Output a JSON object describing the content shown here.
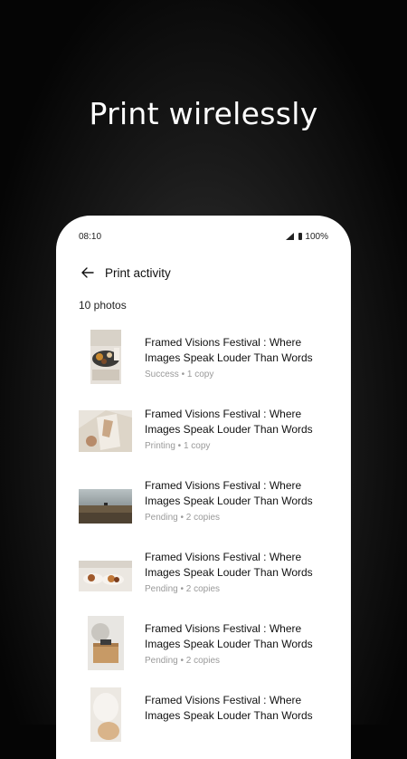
{
  "headline": "Print wirelessly",
  "status_bar": {
    "time": "08:10",
    "battery": "100%"
  },
  "appbar": {
    "title": "Print activity",
    "back_icon": "arrow-left-icon"
  },
  "count_label": "10 photos",
  "items": [
    {
      "title": "Framed Visions Festival : Where Images Speak Louder Than Words",
      "status": "Success",
      "copies": "1 copy",
      "sub": "Success • 1 copy"
    },
    {
      "title": "Framed Visions Festival : Where Images Speak Louder Than Words",
      "status": "Printing",
      "copies": "1 copy",
      "sub": "Printing • 1 copy"
    },
    {
      "title": "Framed Visions Festival : Where Images Speak Louder Than Words",
      "status": "Pending",
      "copies": "2 copies",
      "sub": "Pending • 2 copies"
    },
    {
      "title": "Framed Visions Festival : Where Images Speak Louder Than Words",
      "status": "Pending",
      "copies": "2 copies",
      "sub": "Pending • 2 copies"
    },
    {
      "title": "Framed Visions Festival : Where Images Speak Louder Than Words",
      "status": "Pending",
      "copies": "2 copies",
      "sub": "Pending • 2 copies"
    },
    {
      "title": "Framed Visions Festival : Where Images Speak Louder Than Words",
      "status": "",
      "copies": "",
      "sub": ""
    }
  ],
  "colors": {
    "background": "#0a0a0a",
    "card": "#ffffff",
    "secondary_text": "#9a9a9a"
  }
}
